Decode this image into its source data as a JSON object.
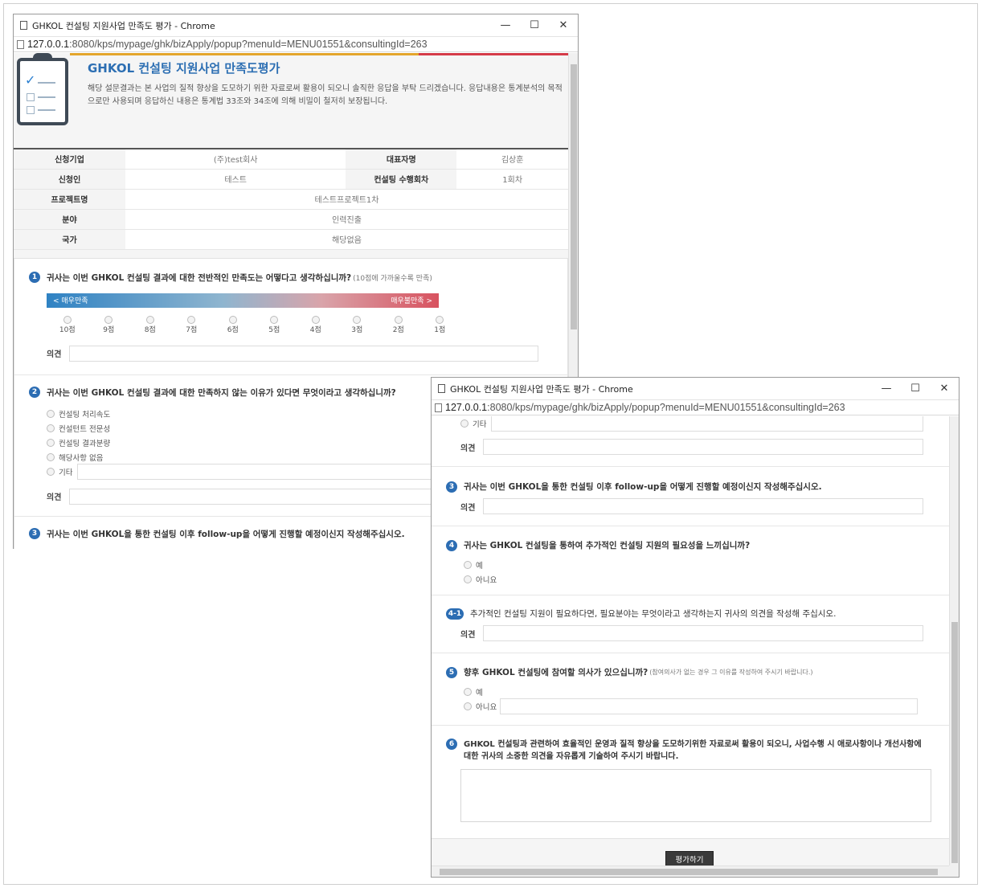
{
  "window1": {
    "title": "GHKOL 컨설팅 지원사업 만족도 평가 - Chrome",
    "url_host": "127.0.0.1",
    "url_path": ":8080/kps/mypage/ghk/bizApply/popup?menuId=MENU01551&consultingId=263",
    "header_title": "GHKOL 컨설팅 지원사업 만족도평가",
    "header_desc": "해당 설문결과는 본 사업의 질적 향상을 도모하기 위한 자료로써 활용이 되오니 솔직한 응답을 부탁 드리겠습니다. 응답내용은 통계분석의 목적으로만 사용되며 응답하신 내용은 통계법 33조와 34조에 의해 비밀이 철저히 보장됩니다.",
    "info": {
      "applicant_label": "신청기업",
      "applicant_value": "(주)test회사",
      "ceo_label": "대표자명",
      "ceo_value": "김상훈",
      "person_label": "신청인",
      "person_value": "테스트",
      "firm_label": "컨설팅 수행회차",
      "firm_value": "1회차",
      "project_label": "프로젝트명",
      "project_value": "테스트프로젝트1차",
      "field_label": "분야",
      "field_value": "인력진출",
      "country_label": "국가",
      "country_value": "해당없음"
    },
    "q1": {
      "num": "1",
      "text": "귀사는 이번 GHKOL 컨설팅 결과에 대한 전반적인 만족도는 어떻다고 생각하십니까?",
      "hint": "(10점에 가까울수록 만족)",
      "scale_left": "< 매우만족",
      "scale_right": "매우불만족 >",
      "points": [
        "10점",
        "9점",
        "8점",
        "7점",
        "6점",
        "5점",
        "4점",
        "3점",
        "2점",
        "1점"
      ]
    },
    "opinion_label": "의견",
    "q2": {
      "num": "2",
      "text": "귀사는 이번 GHKOL 컨설팅 결과에 대한 만족하지 않는 이유가 있다면 무엇이라고 생각하십니까?",
      "options": [
        "컨설팅 처리속도",
        "컨설턴트 전문성",
        "컨설팅 결과분량",
        "해당사항 없음",
        "기타"
      ]
    },
    "q3": {
      "num": "3",
      "text": "귀사는 이번 GHKOL을 통한 컨설팅 이후 follow-up을 어떻게 진행할 예정이신지 작성해주십시오."
    }
  },
  "window2": {
    "title": "GHKOL 컨설팅 지원사업 만족도 평가 - Chrome",
    "url_host": "127.0.0.1",
    "url_path": ":8080/kps/mypage/ghk/bizApply/popup?menuId=MENU01551&consultingId=263",
    "other_label": "기타",
    "opinion_label": "의견",
    "q3": {
      "num": "3",
      "text": "귀사는 이번 GHKOL을 통한 컨설팅 이후 follow-up을 어떻게 진행할 예정이신지 작성해주십시오."
    },
    "q4": {
      "num": "4",
      "text": "귀사는 GHKOL 컨설팅을 통하여 추가적인 컨설팅 지원의 필요성을 느끼십니까?",
      "options": [
        "예",
        "아니요"
      ]
    },
    "q41": {
      "num": "4-1",
      "text": "추가적인 컨설팅 지원이 필요하다면, 필요분야는 무엇이라고 생각하는지 귀사의 의견을 작성해 주십시오."
    },
    "q5": {
      "num": "5",
      "text": "향후 GHKOL 컨설팅에 참여할 의사가 있으십니까?",
      "hint": "(참여의사가 없는 경우 그 이유를 작성하여 주시기 바랍니다.)",
      "options": [
        "예",
        "아니요"
      ]
    },
    "q6": {
      "num": "6",
      "text": "GHKOL 컨설팅과 관련하여 효율적인 운영과 질적 향상을 도모하기위한 자료로써 활용이 되오니, 사업수행 시 애로사항이나 개선사항에 대한 귀사의 소중한 의견을 자유롭게 기술하여 주시기 바랍니다."
    },
    "submit": "평가하기"
  },
  "window_controls": {
    "minimize": "—",
    "maximize": "☐",
    "close": "✕"
  }
}
